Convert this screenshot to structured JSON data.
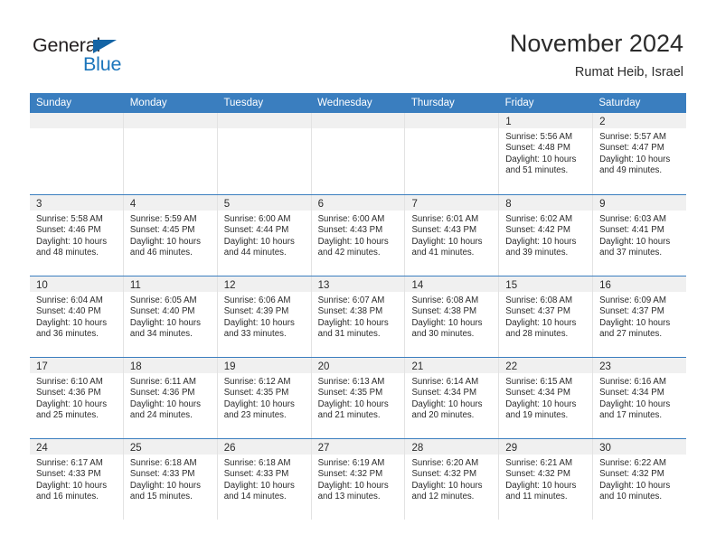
{
  "logo": {
    "word_one": "General",
    "word_two": "Blue",
    "triangle_color": "#1464a5",
    "blue_color": "#1b75bb"
  },
  "header": {
    "title": "November 2024",
    "location": "Rumat Heib, Israel"
  },
  "theme": {
    "header_blue": "#3a7ebf",
    "day_band_gray": "#f0f0f0",
    "cell_border": "#e3e3e3"
  },
  "weekdays": [
    "Sunday",
    "Monday",
    "Tuesday",
    "Wednesday",
    "Thursday",
    "Friday",
    "Saturday"
  ],
  "weeks": [
    [
      {
        "empty": true
      },
      {
        "empty": true
      },
      {
        "empty": true
      },
      {
        "empty": true
      },
      {
        "empty": true
      },
      {
        "day": "1",
        "sunrise": "Sunrise: 5:56 AM",
        "sunset": "Sunset: 4:48 PM",
        "daylight_1": "Daylight: 10 hours",
        "daylight_2": "and 51 minutes."
      },
      {
        "day": "2",
        "sunrise": "Sunrise: 5:57 AM",
        "sunset": "Sunset: 4:47 PM",
        "daylight_1": "Daylight: 10 hours",
        "daylight_2": "and 49 minutes."
      }
    ],
    [
      {
        "day": "3",
        "sunrise": "Sunrise: 5:58 AM",
        "sunset": "Sunset: 4:46 PM",
        "daylight_1": "Daylight: 10 hours",
        "daylight_2": "and 48 minutes."
      },
      {
        "day": "4",
        "sunrise": "Sunrise: 5:59 AM",
        "sunset": "Sunset: 4:45 PM",
        "daylight_1": "Daylight: 10 hours",
        "daylight_2": "and 46 minutes."
      },
      {
        "day": "5",
        "sunrise": "Sunrise: 6:00 AM",
        "sunset": "Sunset: 4:44 PM",
        "daylight_1": "Daylight: 10 hours",
        "daylight_2": "and 44 minutes."
      },
      {
        "day": "6",
        "sunrise": "Sunrise: 6:00 AM",
        "sunset": "Sunset: 4:43 PM",
        "daylight_1": "Daylight: 10 hours",
        "daylight_2": "and 42 minutes."
      },
      {
        "day": "7",
        "sunrise": "Sunrise: 6:01 AM",
        "sunset": "Sunset: 4:43 PM",
        "daylight_1": "Daylight: 10 hours",
        "daylight_2": "and 41 minutes."
      },
      {
        "day": "8",
        "sunrise": "Sunrise: 6:02 AM",
        "sunset": "Sunset: 4:42 PM",
        "daylight_1": "Daylight: 10 hours",
        "daylight_2": "and 39 minutes."
      },
      {
        "day": "9",
        "sunrise": "Sunrise: 6:03 AM",
        "sunset": "Sunset: 4:41 PM",
        "daylight_1": "Daylight: 10 hours",
        "daylight_2": "and 37 minutes."
      }
    ],
    [
      {
        "day": "10",
        "sunrise": "Sunrise: 6:04 AM",
        "sunset": "Sunset: 4:40 PM",
        "daylight_1": "Daylight: 10 hours",
        "daylight_2": "and 36 minutes."
      },
      {
        "day": "11",
        "sunrise": "Sunrise: 6:05 AM",
        "sunset": "Sunset: 4:40 PM",
        "daylight_1": "Daylight: 10 hours",
        "daylight_2": "and 34 minutes."
      },
      {
        "day": "12",
        "sunrise": "Sunrise: 6:06 AM",
        "sunset": "Sunset: 4:39 PM",
        "daylight_1": "Daylight: 10 hours",
        "daylight_2": "and 33 minutes."
      },
      {
        "day": "13",
        "sunrise": "Sunrise: 6:07 AM",
        "sunset": "Sunset: 4:38 PM",
        "daylight_1": "Daylight: 10 hours",
        "daylight_2": "and 31 minutes."
      },
      {
        "day": "14",
        "sunrise": "Sunrise: 6:08 AM",
        "sunset": "Sunset: 4:38 PM",
        "daylight_1": "Daylight: 10 hours",
        "daylight_2": "and 30 minutes."
      },
      {
        "day": "15",
        "sunrise": "Sunrise: 6:08 AM",
        "sunset": "Sunset: 4:37 PM",
        "daylight_1": "Daylight: 10 hours",
        "daylight_2": "and 28 minutes."
      },
      {
        "day": "16",
        "sunrise": "Sunrise: 6:09 AM",
        "sunset": "Sunset: 4:37 PM",
        "daylight_1": "Daylight: 10 hours",
        "daylight_2": "and 27 minutes."
      }
    ],
    [
      {
        "day": "17",
        "sunrise": "Sunrise: 6:10 AM",
        "sunset": "Sunset: 4:36 PM",
        "daylight_1": "Daylight: 10 hours",
        "daylight_2": "and 25 minutes."
      },
      {
        "day": "18",
        "sunrise": "Sunrise: 6:11 AM",
        "sunset": "Sunset: 4:36 PM",
        "daylight_1": "Daylight: 10 hours",
        "daylight_2": "and 24 minutes."
      },
      {
        "day": "19",
        "sunrise": "Sunrise: 6:12 AM",
        "sunset": "Sunset: 4:35 PM",
        "daylight_1": "Daylight: 10 hours",
        "daylight_2": "and 23 minutes."
      },
      {
        "day": "20",
        "sunrise": "Sunrise: 6:13 AM",
        "sunset": "Sunset: 4:35 PM",
        "daylight_1": "Daylight: 10 hours",
        "daylight_2": "and 21 minutes."
      },
      {
        "day": "21",
        "sunrise": "Sunrise: 6:14 AM",
        "sunset": "Sunset: 4:34 PM",
        "daylight_1": "Daylight: 10 hours",
        "daylight_2": "and 20 minutes."
      },
      {
        "day": "22",
        "sunrise": "Sunrise: 6:15 AM",
        "sunset": "Sunset: 4:34 PM",
        "daylight_1": "Daylight: 10 hours",
        "daylight_2": "and 19 minutes."
      },
      {
        "day": "23",
        "sunrise": "Sunrise: 6:16 AM",
        "sunset": "Sunset: 4:34 PM",
        "daylight_1": "Daylight: 10 hours",
        "daylight_2": "and 17 minutes."
      }
    ],
    [
      {
        "day": "24",
        "sunrise": "Sunrise: 6:17 AM",
        "sunset": "Sunset: 4:33 PM",
        "daylight_1": "Daylight: 10 hours",
        "daylight_2": "and 16 minutes."
      },
      {
        "day": "25",
        "sunrise": "Sunrise: 6:18 AM",
        "sunset": "Sunset: 4:33 PM",
        "daylight_1": "Daylight: 10 hours",
        "daylight_2": "and 15 minutes."
      },
      {
        "day": "26",
        "sunrise": "Sunrise: 6:18 AM",
        "sunset": "Sunset: 4:33 PM",
        "daylight_1": "Daylight: 10 hours",
        "daylight_2": "and 14 minutes."
      },
      {
        "day": "27",
        "sunrise": "Sunrise: 6:19 AM",
        "sunset": "Sunset: 4:32 PM",
        "daylight_1": "Daylight: 10 hours",
        "daylight_2": "and 13 minutes."
      },
      {
        "day": "28",
        "sunrise": "Sunrise: 6:20 AM",
        "sunset": "Sunset: 4:32 PM",
        "daylight_1": "Daylight: 10 hours",
        "daylight_2": "and 12 minutes."
      },
      {
        "day": "29",
        "sunrise": "Sunrise: 6:21 AM",
        "sunset": "Sunset: 4:32 PM",
        "daylight_1": "Daylight: 10 hours",
        "daylight_2": "and 11 minutes."
      },
      {
        "day": "30",
        "sunrise": "Sunrise: 6:22 AM",
        "sunset": "Sunset: 4:32 PM",
        "daylight_1": "Daylight: 10 hours",
        "daylight_2": "and 10 minutes."
      }
    ]
  ]
}
